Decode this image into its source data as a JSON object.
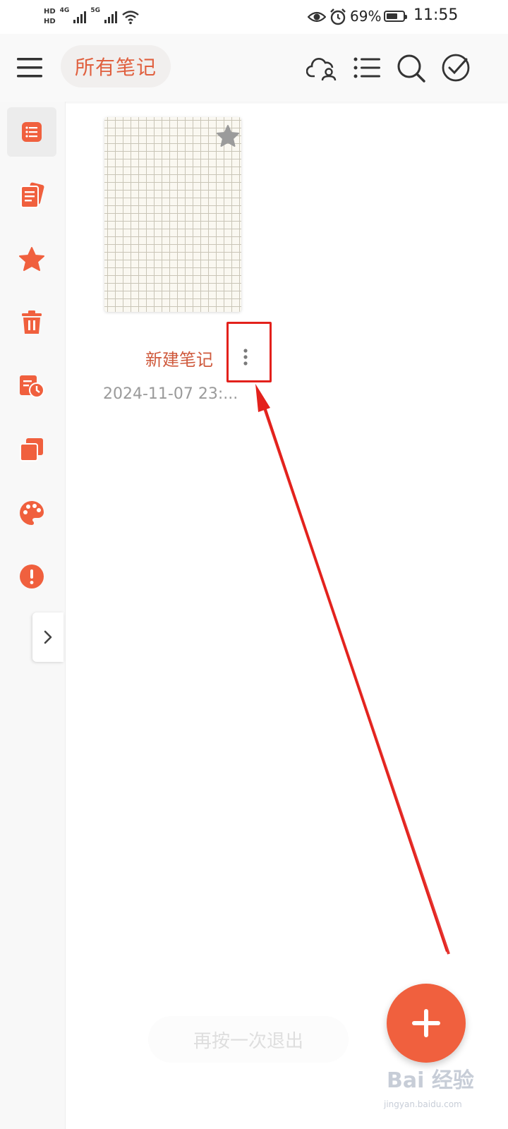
{
  "status_bar": {
    "sim1": "HD",
    "sim2": "HD",
    "net1": "4G",
    "net2": "5G",
    "battery_percent": "69%",
    "battery_level": 0.69,
    "time": "11:55",
    "icons": [
      "eye-icon",
      "alarm-icon",
      "wifi-icon"
    ]
  },
  "header": {
    "title": "所有笔记",
    "icons": [
      "menu-icon",
      "cloud-account-icon",
      "list-view-icon",
      "search-icon",
      "select-check-icon"
    ]
  },
  "sidebar": {
    "items": [
      {
        "icon": "all-notes-icon",
        "active": true
      },
      {
        "icon": "notebooks-icon",
        "active": false
      },
      {
        "icon": "favorites-star-icon",
        "active": false
      },
      {
        "icon": "trash-icon",
        "active": false
      },
      {
        "icon": "history-icon",
        "active": false
      },
      {
        "icon": "templates-icon",
        "active": false
      },
      {
        "icon": "theme-palette-icon",
        "active": false
      },
      {
        "icon": "feedback-alert-icon",
        "active": false
      }
    ],
    "expand_icon": "chevron-right-icon"
  },
  "notes": [
    {
      "title": "新建笔记",
      "date": "2024-11-07 23:...",
      "starred": false
    }
  ],
  "toast": {
    "text": "再按一次退出"
  },
  "fab": {
    "icon": "plus-icon"
  },
  "colors": {
    "accent": "#f0603e",
    "title_text": "#cf5a3d",
    "annotation": "#e3211c"
  },
  "watermark": {
    "brand": "Bai 经验",
    "url": "jingyan.baidu.com"
  }
}
